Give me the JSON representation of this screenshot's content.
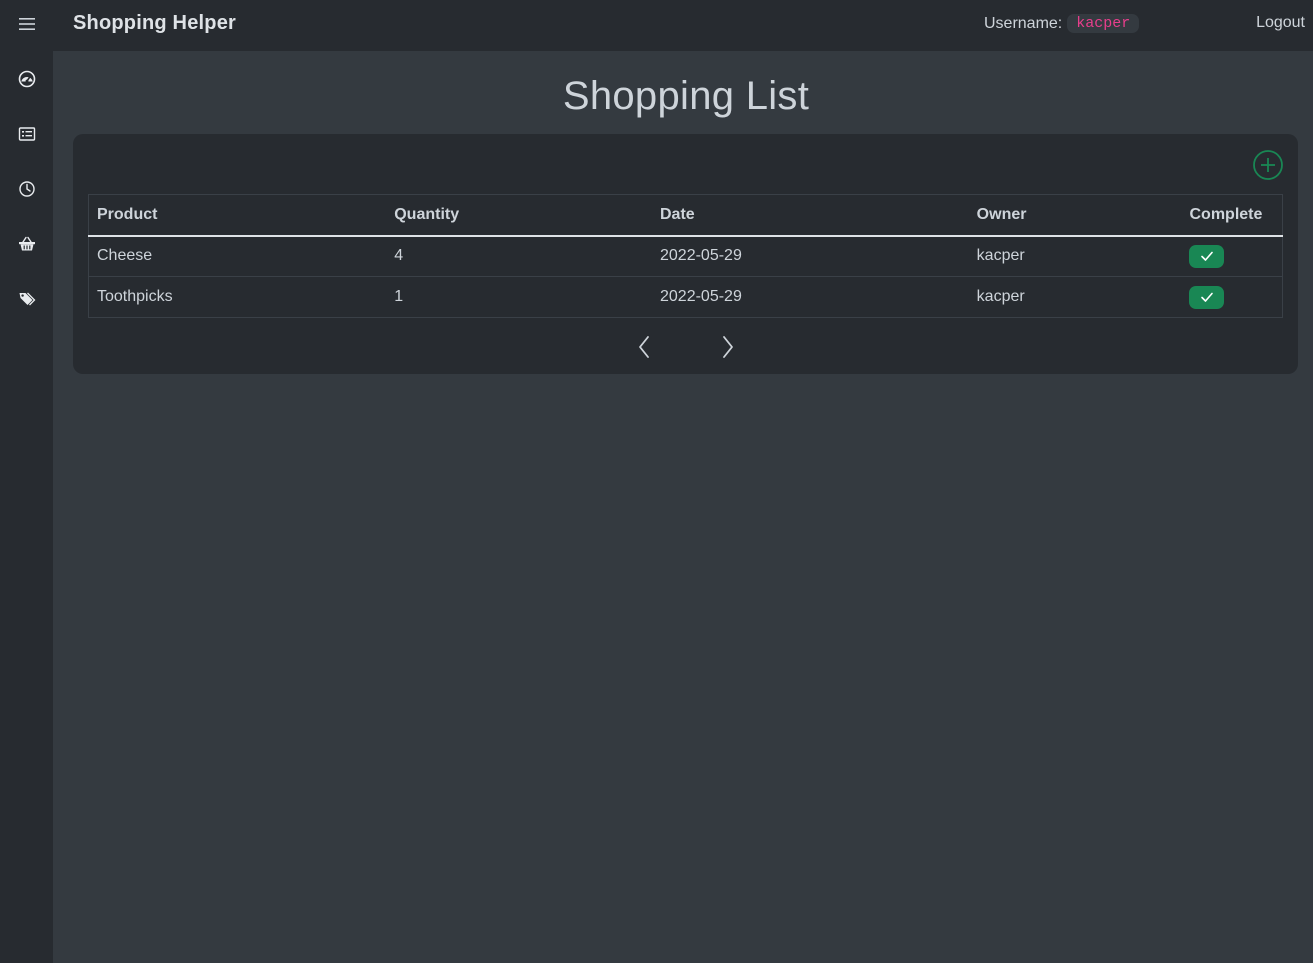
{
  "app": {
    "title": "Shopping Helper"
  },
  "header": {
    "username_label": "Username:",
    "username": "kacper",
    "logout_label": "Logout"
  },
  "sidebar": {
    "items": [
      {
        "icon": "menu-icon"
      },
      {
        "icon": "dashboard-icon"
      },
      {
        "icon": "list-icon"
      },
      {
        "icon": "history-icon"
      },
      {
        "icon": "basket-icon"
      },
      {
        "icon": "tags-icon"
      }
    ]
  },
  "main": {
    "title": "Shopping List",
    "table": {
      "columns": [
        "Product",
        "Quantity",
        "Date",
        "Owner",
        "Complete"
      ],
      "rows": [
        {
          "product": "Cheese",
          "quantity": "4",
          "date": "2022-05-29",
          "owner": "kacper",
          "complete": true
        },
        {
          "product": "Toothpicks",
          "quantity": "1",
          "date": "2022-05-29",
          "owner": "kacper",
          "complete": true
        }
      ]
    }
  },
  "colors": {
    "accent_green": "#198754",
    "username_pink": "#e83e8c",
    "background": "#343a40",
    "panel": "#272b30"
  }
}
